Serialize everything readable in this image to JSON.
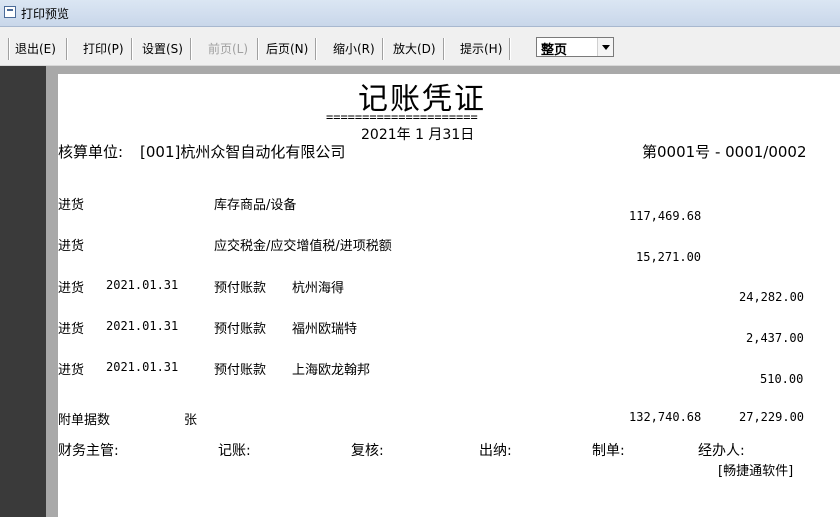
{
  "window": {
    "title": "打印预览"
  },
  "toolbar": {
    "exit": "退出(E)",
    "print": "打印(P)",
    "settings": "设置(S)",
    "prev": "前页(L)",
    "next": "后页(N)",
    "zoom_out": "缩小(R)",
    "zoom_in": "放大(D)",
    "hint": "提示(H)",
    "page_mode": "整页"
  },
  "voucher": {
    "title": "记账凭证",
    "underline": "=====================",
    "date": "2021年 1 月31日",
    "unit_label": "核算单位: ",
    "unit_value": "[001]杭州众智自动化有限公司",
    "number": "第0001号 - 0001/0002",
    "rows": [
      {
        "summary": "进货",
        "date": "",
        "account": "库存商品/设备",
        "aux": "",
        "debit": "117,469.68",
        "credit": ""
      },
      {
        "summary": "进货",
        "date": "",
        "account": "应交税金/应交增值税/进项税额",
        "aux": "",
        "debit": "15,271.00",
        "credit": ""
      },
      {
        "summary": "进货",
        "date": "2021.01.31",
        "account": "预付账款",
        "aux": "杭州海得",
        "debit": "",
        "credit": "24,282.00"
      },
      {
        "summary": "进货",
        "date": "2021.01.31",
        "account": "预付账款",
        "aux": "福州欧瑞特",
        "debit": "",
        "credit": "2,437.00"
      },
      {
        "summary": "进货",
        "date": "2021.01.31",
        "account": "预付账款",
        "aux": "上海欧龙翰邦",
        "debit": "",
        "credit": "510.00"
      }
    ],
    "attach_label": "附单据数",
    "attach_unit": "张",
    "total_debit": "132,740.68",
    "total_credit": "27,229.00",
    "signatures": {
      "finance_manager": "财务主管:",
      "bookkeeper": "记账:",
      "reviewer": "复核:",
      "cashier": "出纳:",
      "preparer": "制单:",
      "handler": "经办人:"
    },
    "software": "[畅捷通软件]"
  }
}
